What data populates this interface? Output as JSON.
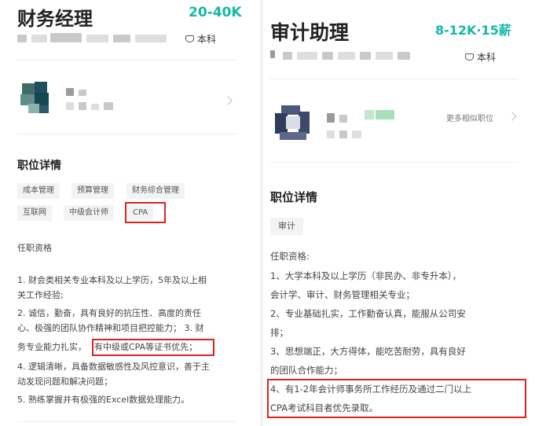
{
  "left": {
    "title": "财务经理",
    "salary": "20-40K",
    "education": "本科",
    "section_title": "职位详情",
    "tags": [
      "成本管理",
      "预算管理",
      "财务综合管理",
      "互联网",
      "中级会计师",
      "CPA"
    ],
    "requirements_heading": "任职资格",
    "requirements": [
      "1. 财会类相关专业本科及以上学历，5年及以上相",
      "关工作经验;",
      "2. 诚信，勤奋，具有良好的抗压性、高度的责任",
      "心、极强的团队协作精神和项目把控能力； 3. 财",
      "务专业能力扎实，",
      "有中级或CPA等证书优先；",
      "4. 逻辑清晰，具备数据敏感性及风控意识，善于主",
      "动发现问题和解决问题；",
      "5. 熟练掌握并有极强的Excel数据处理能力。"
    ]
  },
  "right": {
    "title": "审计助理",
    "salary": "8-12K·15薪",
    "education": "本科",
    "more_similar": "更多相似职位",
    "section_title": "职位详情",
    "tags": [
      "审计"
    ],
    "requirements_heading": "任职资格:",
    "requirements": [
      "1、大学本科及以上学历（非民办、非专升本），",
      "会计学、审计、财务管理相关专业；",
      "2、专业基础扎实，工作勤奋认真，能服从公司安",
      "排；",
      "3、思想端正，大方得体，能吃苦耐劳，具有良好",
      "的团队合作能力；",
      "4、有1-2年会计师事务所工作经历及通过二门以上",
      "CPA考试科目者优先录取。"
    ]
  },
  "colors": {
    "salary": "#14b8a6",
    "highlight_box": "#e02020",
    "tag_bg": "#f2f3f5"
  }
}
